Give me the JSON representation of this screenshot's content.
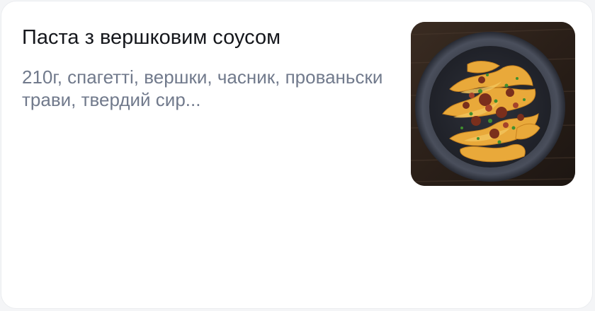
{
  "card": {
    "title": "Паста з вершковим соусом",
    "description": "210г, спагетті, вершки, часник, прованьски трави, твердий сир...",
    "image": {
      "alt": "pasta-dish-photo",
      "icon": "pasta-bowl-photo"
    }
  }
}
